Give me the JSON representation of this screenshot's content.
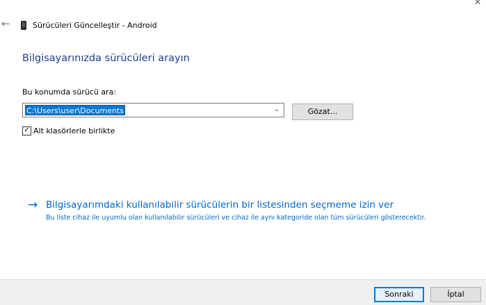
{
  "window": {
    "title": "Sürücüleri Güncelleştir - Android",
    "back_icon": "arrow-left-icon",
    "close_icon": "close-icon",
    "device_icon": "phone-icon"
  },
  "heading": "Bilgisayarınızda sürücüleri arayın",
  "search": {
    "label": "Bu konumda sürücü ara:",
    "path_value": "C:\\Users\\user\\Documents",
    "browse_label": "Gözat...",
    "include_subfolders_label": "Alt klasörlerle birlikte",
    "include_subfolders_checked": true
  },
  "pick_option": {
    "title": "Bilgisayarımdaki kullanılabilir sürücülerin bir listesinden seçmeme izin ver",
    "description": "Bu liste cihaz ile uyumlu olan kullanılabilir sürücüleri ve cihaz ile aynı kategoride olan tüm sürücüleri gösterecektir."
  },
  "footer": {
    "next_label": "Sonraki",
    "cancel_label": "İptal"
  },
  "colors": {
    "heading": "#1d3e8c",
    "link": "#0066cc",
    "selection": "#0078d7"
  }
}
